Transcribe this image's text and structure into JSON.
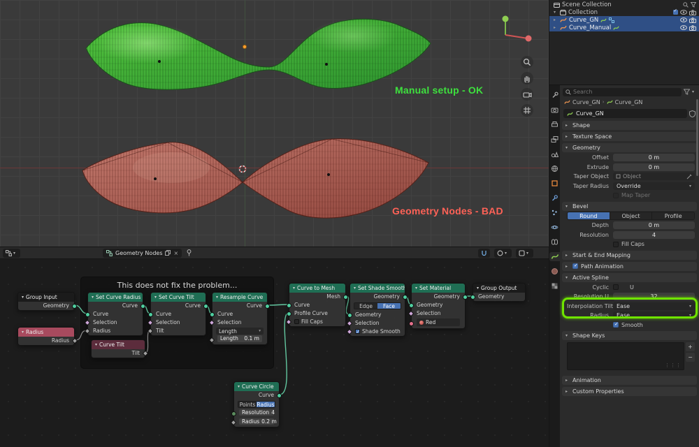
{
  "colors": {
    "accent_blue": "#4772b3",
    "highlight_green": "#6fe400",
    "label_ok_green": "#3ee03e",
    "label_bad_red": "#ff6257",
    "node_header_teal": "#1f6e54"
  },
  "viewport": {
    "label_ok": "Manual setup - OK",
    "label_bad": "Geometry Nodes - BAD"
  },
  "node_editor_header": {
    "tree_name": "Geometry Nodes"
  },
  "frame": {
    "label": "This does not fix the problem..."
  },
  "nodes": {
    "group_input": {
      "title": "Group Input",
      "geometry_out": "Geometry"
    },
    "radius_input": {
      "title": "Radius",
      "radius_out": "Radius"
    },
    "set_curve_radius": {
      "title": "Set Curve Radius",
      "curve_out": "Curve",
      "curve_in": "Curve",
      "selection_in": "Selection",
      "radius_in": "Radius"
    },
    "set_curve_tilt": {
      "title": "Set Curve Tilt",
      "curve_out": "Curve",
      "curve_in": "Curve",
      "selection_in": "Selection",
      "tilt_in": "Tilt"
    },
    "curve_tilt": {
      "title": "Curve Tilt",
      "tilt_out": "Tilt"
    },
    "resample_curve": {
      "title": "Resample Curve",
      "curve_out": "Curve",
      "curve_in": "Curve",
      "selection_in": "Selection",
      "mode": "Length",
      "length_label": "Length",
      "length_value": "0.1 m"
    },
    "curve_to_mesh": {
      "title": "Curve to Mesh",
      "mesh_out": "Mesh",
      "curve_in": "Curve",
      "profile_in": "Profile Curve",
      "fill_caps": "Fill Caps"
    },
    "set_shade_smooth": {
      "title": "Set Shade Smooth",
      "geometry_out": "Geometry",
      "domain_edge": "Edge",
      "domain_face": "Face",
      "geometry_in": "Geometry",
      "selection_in": "Selection",
      "shade_smooth_in": "Shade Smooth"
    },
    "set_material": {
      "title": "Set Material",
      "geometry_out": "Geometry",
      "geometry_in": "Geometry",
      "selection_in": "Selection",
      "material_value": "Red"
    },
    "group_output": {
      "title": "Group Output",
      "geometry_in": "Geometry"
    },
    "curve_circle": {
      "title": "Curve Circle",
      "curve_out": "Curve",
      "mode_points": "Points",
      "mode_radius": "Radius",
      "resolution_label": "Resolution",
      "resolution_value": "4",
      "radius_label": "Radius",
      "radius_value": "0.2 m"
    }
  },
  "outliner": {
    "scene_collection": "Scene Collection",
    "collection": "Collection",
    "curve_gn": "Curve_GN",
    "curve_manual": "Curve_Manual"
  },
  "properties": {
    "search_placeholder": "Search",
    "breadcrumb_object": "Curve_GN",
    "breadcrumb_data": "Curve_GN",
    "name_value": "Curve_GN",
    "shape": "Shape",
    "texture_space": "Texture Space",
    "geometry": {
      "title": "Geometry",
      "offset_label": "Offset",
      "offset_value": "0 m",
      "extrude_label": "Extrude",
      "extrude_value": "0 m",
      "taper_object_label": "Taper Object",
      "taper_object_value": "Object",
      "taper_radius_label": "Taper Radius",
      "taper_radius_value": "Override",
      "map_taper": "Map Taper"
    },
    "bevel": {
      "title": "Bevel",
      "tab_round": "Round",
      "tab_object": "Object",
      "tab_profile": "Profile",
      "depth_label": "Depth",
      "depth_value": "0 m",
      "resolution_label": "Resolution",
      "resolution_value": "4",
      "fill_caps": "Fill Caps"
    },
    "start_end_mapping": "Start & End Mapping",
    "path_animation": "Path Animation",
    "active_spline": {
      "title": "Active Spline",
      "cyclic_label": "Cyclic",
      "cyclic_u": "U",
      "resolution_label": "Resolution U",
      "resolution_value": "32",
      "interpolation_label": "Interpolation Tilt",
      "interpolation_value": "Ease",
      "radius_label": "Radius",
      "radius_value": "Ease",
      "smooth": "Smooth"
    },
    "shape_keys": "Shape Keys",
    "animation": "Animation",
    "custom_properties": "Custom Properties"
  }
}
